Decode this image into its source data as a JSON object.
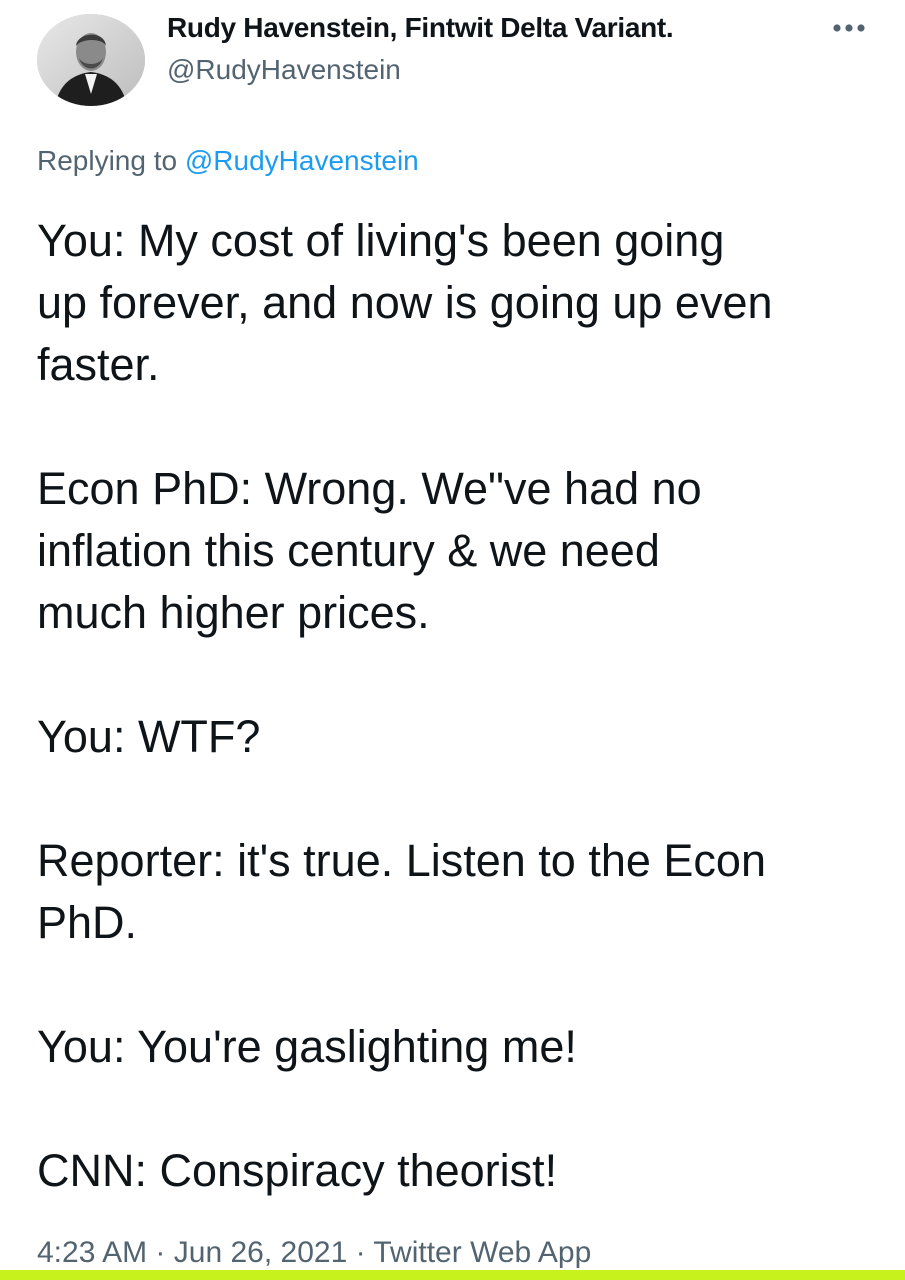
{
  "author": {
    "display_name": "Rudy Havenstein, Fintwit Delta Variant.",
    "handle": "@RudyHavenstein"
  },
  "more_icon": "more-horizontal-icon",
  "reply": {
    "prefix": "Replying to",
    "target": "@RudyHavenstein"
  },
  "tweet": {
    "paragraphs": [
      {
        "lines": [
          "You: My cost of living's been going",
          "up forever, and now is going up even",
          "faster."
        ]
      },
      {
        "lines": [
          "Econ PhD: Wrong. We\"ve had no",
          "inflation this century & we need",
          "much higher prices."
        ]
      },
      {
        "lines": [
          "You: WTF?"
        ]
      },
      {
        "lines": [
          "Reporter: it's true. Listen to the Econ",
          "PhD."
        ]
      },
      {
        "lines": [
          "You: You're gaslighting me!"
        ]
      },
      {
        "lines": [
          "CNN: Conspiracy theorist!"
        ]
      }
    ]
  },
  "meta": {
    "time": "4:23 AM",
    "date": "Jun 26, 2021",
    "source": "Twitter Web App",
    "separator": "·"
  },
  "colors": {
    "secondary_text": "#536471",
    "link": "#1d9bf0",
    "highlight_bar": "#c8f21c"
  }
}
